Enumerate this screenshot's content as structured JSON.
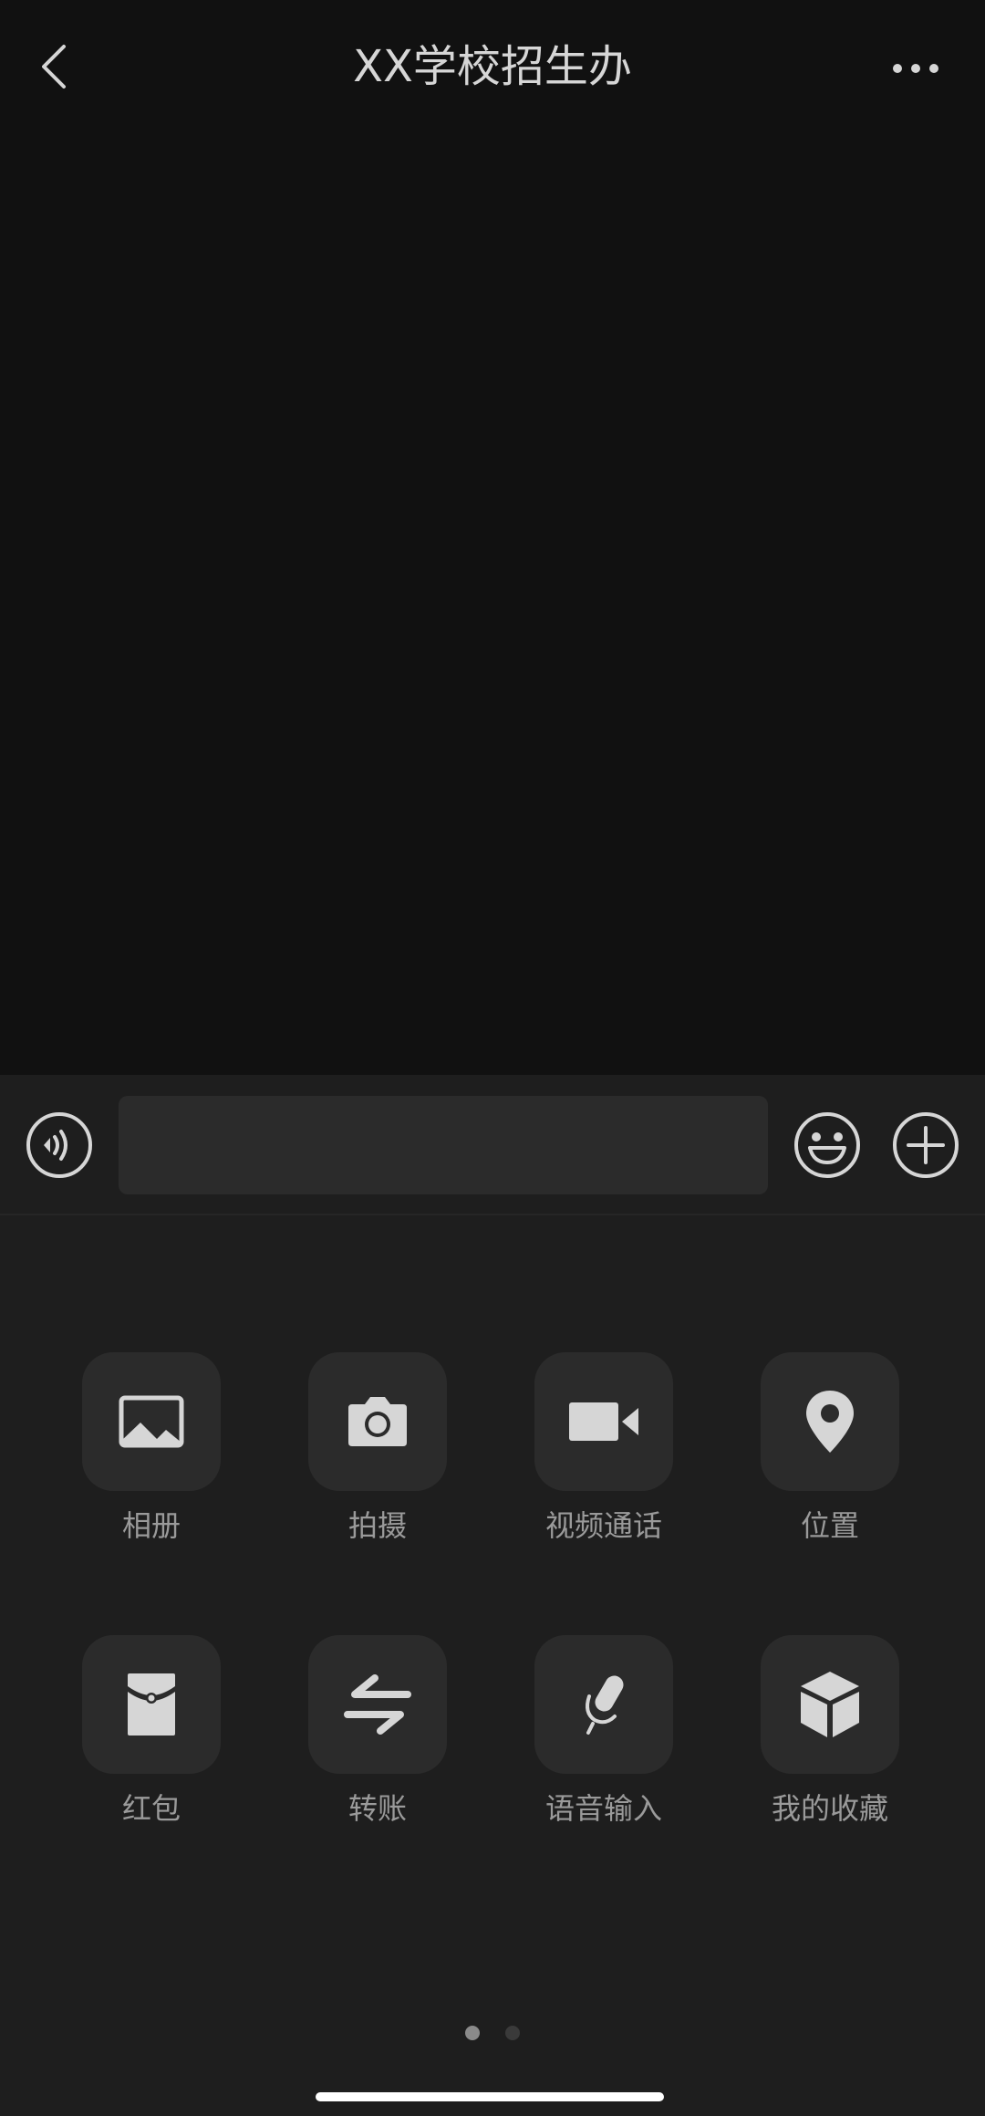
{
  "header": {
    "title": "XX学校招生办"
  },
  "input": {
    "value": "",
    "placeholder": ""
  },
  "icons": {
    "back": "chevron-left-icon",
    "more": "more-dots-icon",
    "voice": "voice-icon",
    "emoji": "emoji-icon",
    "plus": "plus-icon"
  },
  "tools": [
    {
      "label": "相册",
      "icon": "image-icon"
    },
    {
      "label": "拍摄",
      "icon": "camera-icon"
    },
    {
      "label": "视频通话",
      "icon": "video-icon"
    },
    {
      "label": "位置",
      "icon": "location-icon"
    },
    {
      "label": "红包",
      "icon": "red-packet-icon"
    },
    {
      "label": "转账",
      "icon": "transfer-icon"
    },
    {
      "label": "语音输入",
      "icon": "microphone-icon"
    },
    {
      "label": "我的收藏",
      "icon": "favorites-box-icon"
    }
  ],
  "pager": {
    "pages": 2,
    "current": 1
  },
  "colors": {
    "background": "#111111",
    "panel": "#1e1e1e",
    "tile": "#2b2b2b",
    "icon": "#d6d6d6",
    "label": "#9a9a9a"
  }
}
